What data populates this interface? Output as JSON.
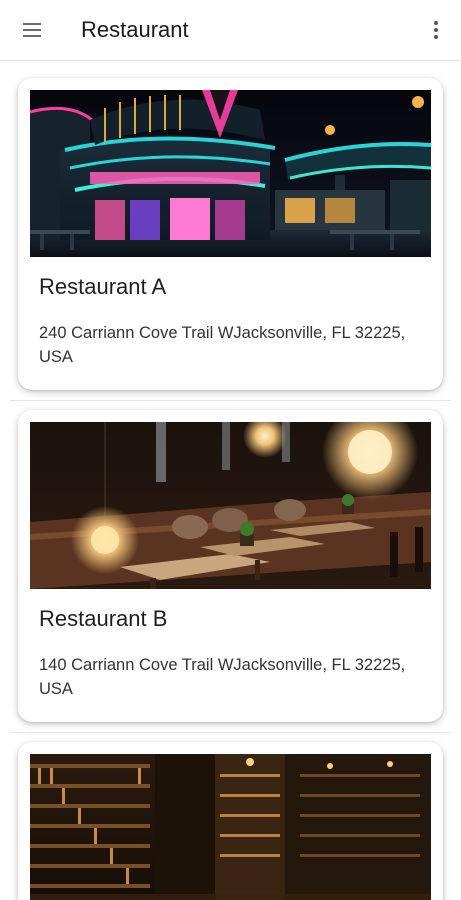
{
  "app_bar": {
    "title": "Restaurant",
    "menu_icon": "hamburger-menu-icon",
    "more_icon": "more-vert-icon"
  },
  "restaurants": [
    {
      "name": "Restaurant A",
      "address": "240 Carriann Cove Trail WJacksonville, FL 32225, USA"
    },
    {
      "name": "Restaurant B",
      "address": "140 Carriann Cove Trail WJacksonville, FL 32225, USA"
    },
    {
      "name": "",
      "address": ""
    }
  ],
  "colors": {
    "app_bar_background": "#ffffff",
    "card_background": "#ffffff",
    "title_text": "#1a1a1a",
    "secondary_text": "#333333",
    "neon_pink": "#ff3fa4",
    "neon_teal": "#29d4d9"
  }
}
